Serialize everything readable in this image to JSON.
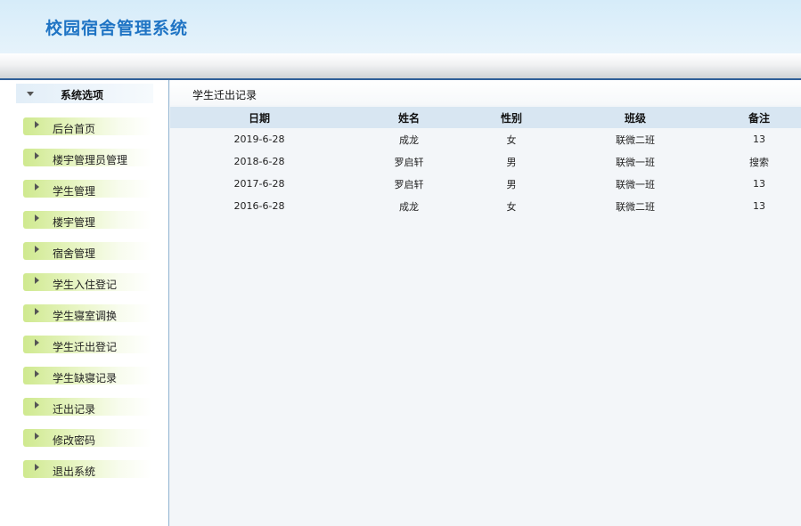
{
  "app": {
    "title": "校园宿舍管理系统"
  },
  "sidebar": {
    "heading": "系统选项",
    "items": [
      {
        "label": "后台首页"
      },
      {
        "label": "楼宇管理员管理"
      },
      {
        "label": "学生管理"
      },
      {
        "label": "楼宇管理"
      },
      {
        "label": "宿舍管理"
      },
      {
        "label": "学生入住登记"
      },
      {
        "label": "学生寝室调换"
      },
      {
        "label": "学生迁出登记"
      },
      {
        "label": "学生缺寝记录"
      },
      {
        "label": "迁出记录"
      },
      {
        "label": "修改密码"
      },
      {
        "label": "退出系统"
      }
    ]
  },
  "main": {
    "title": "学生迁出记录",
    "table": {
      "columns": [
        "日期",
        "姓名",
        "性别",
        "班级",
        "备注"
      ],
      "rows": [
        [
          "2019-6-28",
          "成龙",
          "女",
          "联微二班",
          "13"
        ],
        [
          "2018-6-28",
          "罗启轩",
          "男",
          "联微一班",
          "搜索"
        ],
        [
          "2017-6-28",
          "罗启轩",
          "男",
          "联微一班",
          "13"
        ],
        [
          "2016-6-28",
          "成龙",
          "女",
          "联微二班",
          "13"
        ]
      ]
    }
  }
}
